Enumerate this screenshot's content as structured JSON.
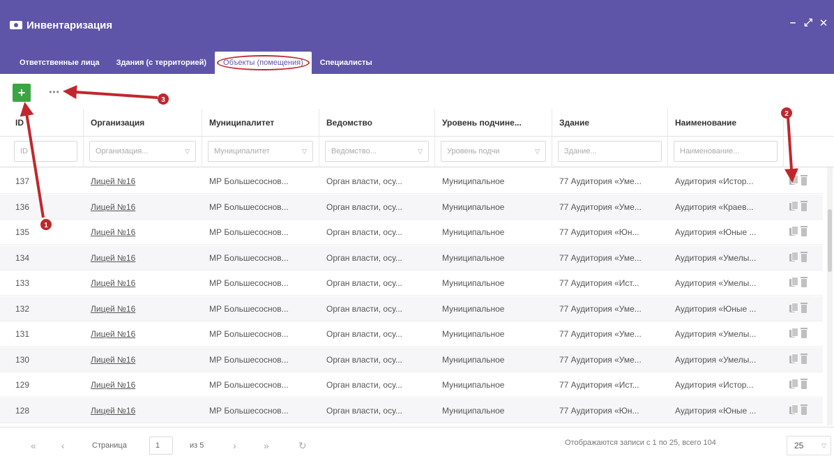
{
  "window": {
    "title": "Инвентаризация",
    "controls": {
      "minimize": "–",
      "maximize": "⤢",
      "close": "✕"
    }
  },
  "tabs": [
    {
      "label": "Ответственные лица",
      "active": false
    },
    {
      "label": "Здания (с территорией)",
      "active": false
    },
    {
      "label": "Объекты (помещения)",
      "active": true
    },
    {
      "label": "Специалисты",
      "active": false
    }
  ],
  "toolbar": {
    "add_label": "+",
    "more_label": "•••"
  },
  "grid": {
    "columns": [
      {
        "key": "id",
        "label": "ID",
        "filter_placeholder": "ID",
        "has_dropdown": false
      },
      {
        "key": "org",
        "label": "Организация",
        "filter_placeholder": "Организация...",
        "has_dropdown": true
      },
      {
        "key": "muni",
        "label": "Муниципалитет",
        "filter_placeholder": "Муниципалитет",
        "has_dropdown": true
      },
      {
        "key": "dept",
        "label": "Ведомство",
        "filter_placeholder": "Ведомство...",
        "has_dropdown": true
      },
      {
        "key": "level",
        "label": "Уровень подчине...",
        "filter_placeholder": "Уровень подчи",
        "has_dropdown": true
      },
      {
        "key": "building",
        "label": "Здание",
        "filter_placeholder": "Здание...",
        "has_dropdown": false
      },
      {
        "key": "name",
        "label": "Наименование",
        "filter_placeholder": "Наименование...",
        "has_dropdown": false
      }
    ],
    "rows": [
      {
        "id": "137",
        "org": "Лицей №16",
        "muni": "МР Большесоснов...",
        "dept": "Орган власти, осу...",
        "level": "Муниципальное",
        "building": "77 Аудитория «Уме...",
        "name": "Аудитория «Истор..."
      },
      {
        "id": "136",
        "org": "Лицей №16",
        "muni": "МР Большесоснов...",
        "dept": "Орган власти, осу...",
        "level": "Муниципальное",
        "building": "77 Аудитория «Уме...",
        "name": "Аудитория «Краев..."
      },
      {
        "id": "135",
        "org": "Лицей №16",
        "muni": "МР Большесоснов...",
        "dept": "Орган власти, осу...",
        "level": "Муниципальное",
        "building": "77 Аудитория «Юн...",
        "name": "Аудитория «Юные ..."
      },
      {
        "id": "134",
        "org": "Лицей №16",
        "muni": "МР Большесоснов...",
        "dept": "Орган власти, осу...",
        "level": "Муниципальное",
        "building": "77 Аудитория «Уме...",
        "name": "Аудитория «Умелы..."
      },
      {
        "id": "133",
        "org": "Лицей №16",
        "muni": "МР Большесоснов...",
        "dept": "Орган власти, осу...",
        "level": "Муниципальное",
        "building": "77 Аудитория «Ист...",
        "name": "Аудитория «Умелы..."
      },
      {
        "id": "132",
        "org": "Лицей №16",
        "muni": "МР Большесоснов...",
        "dept": "Орган власти, осу...",
        "level": "Муниципальное",
        "building": "77 Аудитория «Уме...",
        "name": "Аудитория «Юные ..."
      },
      {
        "id": "131",
        "org": "Лицей №16",
        "muni": "МР Большесоснов...",
        "dept": "Орган власти, осу...",
        "level": "Муниципальное",
        "building": "77 Аудитория «Уме...",
        "name": "Аудитория «Умелы..."
      },
      {
        "id": "130",
        "org": "Лицей №16",
        "muni": "МР Большесоснов...",
        "dept": "Орган власти, осу...",
        "level": "Муниципальное",
        "building": "77 Аудитория «Уме...",
        "name": "Аудитория «Умелы..."
      },
      {
        "id": "129",
        "org": "Лицей №16",
        "muni": "МР Большесоснов...",
        "dept": "Орган власти, осу...",
        "level": "Муниципальное",
        "building": "77 Аудитория «Ист...",
        "name": "Аудитория «Истор..."
      },
      {
        "id": "128",
        "org": "Лицей №16",
        "muni": "МР Большесоснов...",
        "dept": "Орган власти, осу...",
        "level": "Муниципальное",
        "building": "77 Аудитория «Юн...",
        "name": "Аудитория «Юные ..."
      }
    ]
  },
  "pager": {
    "first": "«",
    "prev": "‹",
    "page_label": "Страница",
    "page_value": "1",
    "of_label": "из 5",
    "next": "›",
    "last": "»",
    "refresh": "↻",
    "info": "Отображаются записи с 1 по 25, всего 104",
    "page_size": "25"
  },
  "annotations": {
    "markers": [
      "1",
      "2",
      "3"
    ],
    "color": "#c0272d"
  },
  "colors": {
    "header": "#5e55a8",
    "add_button": "#3aa544",
    "annotation": "#c0272d"
  },
  "icons": [
    "app-icon",
    "copy-icon",
    "delete-icon",
    "caret-down-icon",
    "refresh-icon"
  ]
}
